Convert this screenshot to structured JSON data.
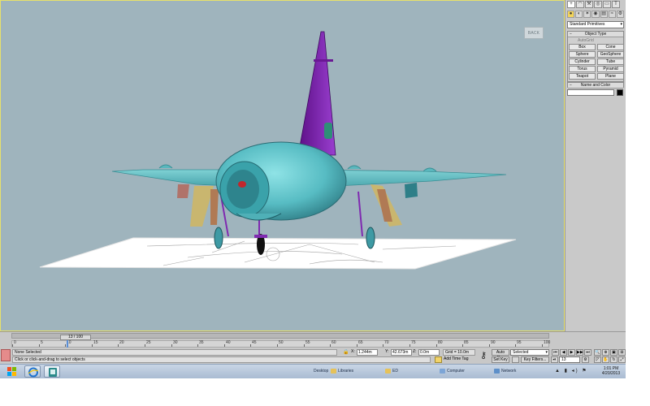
{
  "viewport": {
    "viewcube_label": "BACK",
    "colors": {
      "background": "#9fb4bd",
      "border": "#e7e06a",
      "fuselage": "#5fc2c8",
      "tail": "#7b1aa6"
    }
  },
  "command_panel": {
    "tabs": [
      "+",
      "◠",
      "⚒",
      "◎",
      "▭",
      "T"
    ],
    "icons": [
      "●",
      "◐",
      "✶",
      "◉",
      "▤",
      "≈",
      "⚙"
    ],
    "category": "Standard Primitives",
    "object_type": {
      "title": "Object Type",
      "autogrid": "AutoGrid",
      "buttons": [
        "Box",
        "Cone",
        "Sphere",
        "GeoSphere",
        "Cylinder",
        "Tube",
        "Torus",
        "Pyramid",
        "Teapot",
        "Plane"
      ]
    },
    "name_color": {
      "title": "Name and Color",
      "name_value": ""
    }
  },
  "timeline": {
    "position_label": "13 / 100",
    "ticks": [
      "0",
      "5",
      "10",
      "15",
      "20",
      "25",
      "30",
      "35",
      "40",
      "45",
      "50",
      "55",
      "60",
      "65",
      "70",
      "75",
      "80",
      "85",
      "90",
      "95",
      "100"
    ]
  },
  "status": {
    "selection": "None Selected",
    "prompt": "Click or click-and-drag to select objects",
    "x_label": "X:",
    "x_value": "1.244m",
    "y_label": "Y:",
    "y_value": "42.673m",
    "z_label": "Z:",
    "z_value": "0.0m",
    "grid": "Grid = 10.0m",
    "add_time_tag": "Add Time Tag",
    "auto_key": "Auto Key",
    "set_key": "Set Key",
    "selected_option": "Selected",
    "key_filters": "Key Filters...",
    "frame": "13",
    "playback": [
      "⏮",
      "◀",
      "▶",
      "▶▶",
      "⏭"
    ]
  },
  "taskbar": {
    "desktop_label": "Desktop",
    "links": [
      "Libraries",
      "ED",
      "Computer",
      "Network"
    ],
    "tray": "▲ ▮ ◂) ⚑",
    "time": "1:01 PM",
    "date": "4/20/2013"
  }
}
